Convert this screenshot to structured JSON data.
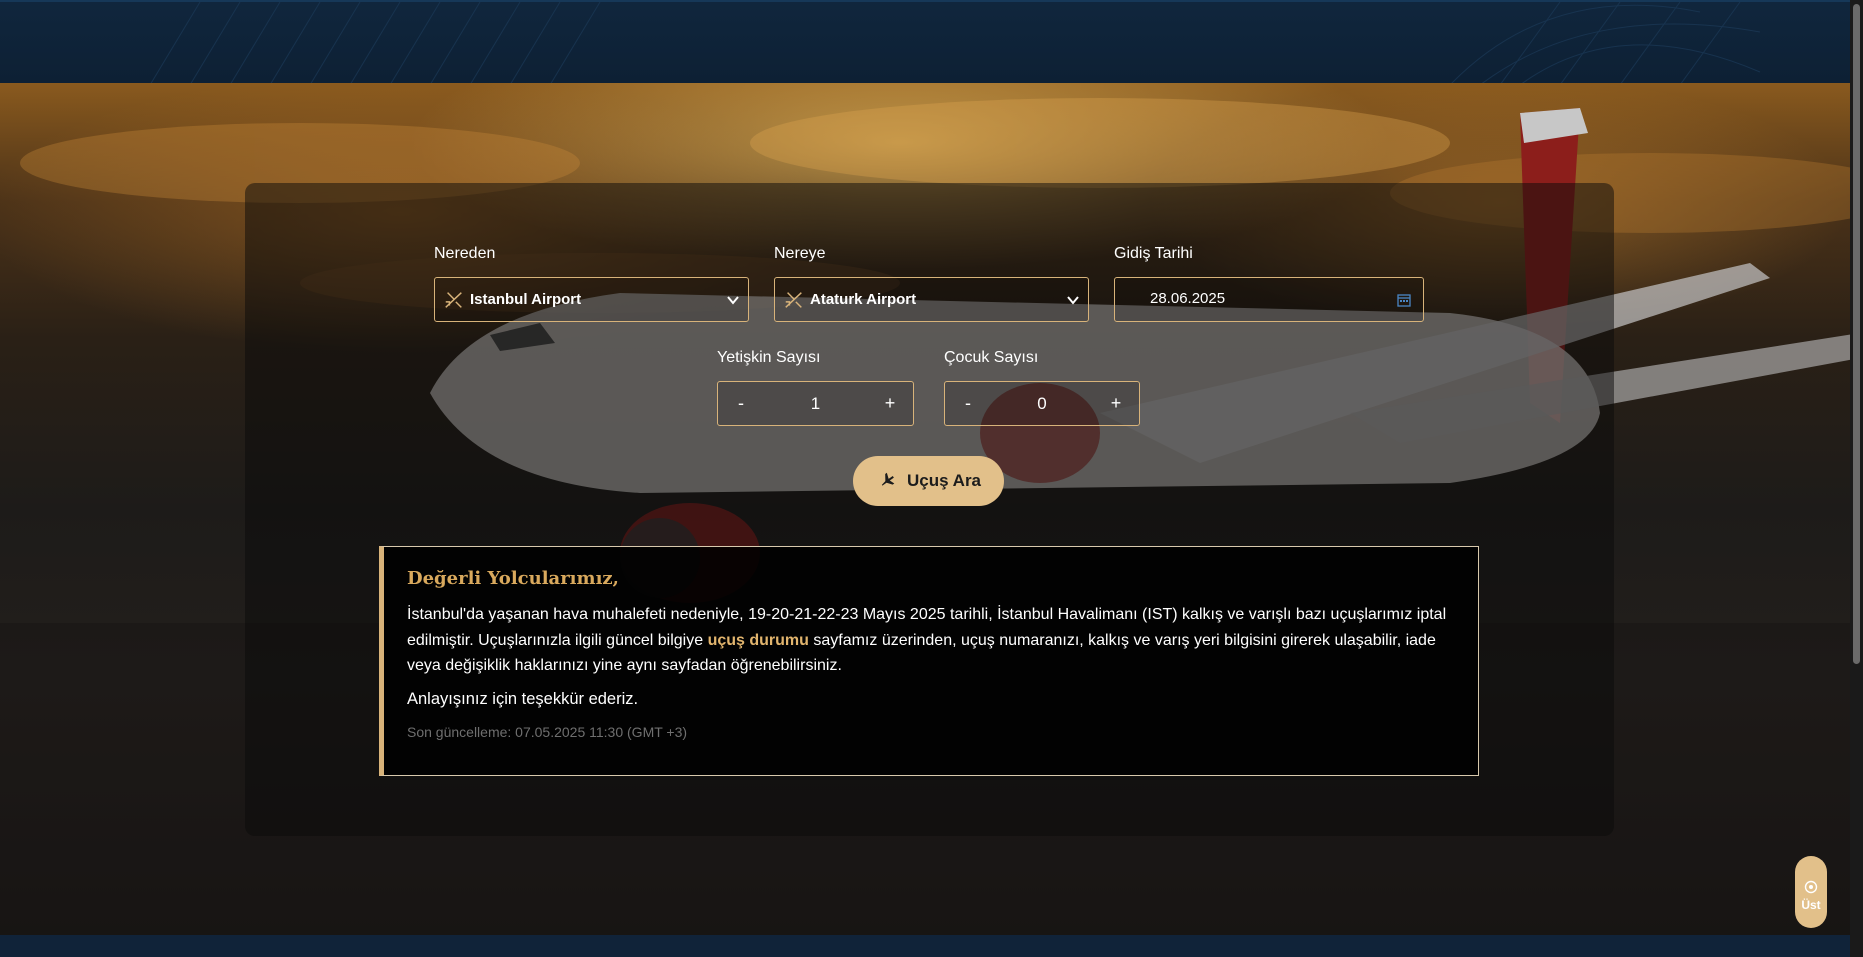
{
  "search_form": {
    "from": {
      "label": "Nereden",
      "value": "Istanbul Airport"
    },
    "to": {
      "label": "Nereye",
      "value": "Ataturk Airport"
    },
    "departure_date": {
      "label": "Gidiş Tarihi",
      "value": "28.06.2025"
    },
    "adults": {
      "label": "Yetişkin Sayısı",
      "value": "1",
      "minus": "-",
      "plus": "+"
    },
    "children": {
      "label": "Çocuk Sayısı",
      "value": "0",
      "minus": "-",
      "plus": "+"
    },
    "search_button": "Uçuş Ara"
  },
  "notice": {
    "title": "Değerli Yolcularımız,",
    "body_before_link": "İstanbul'da yaşanan hava muhalefeti nedeniyle, 19-20-21-22-23 Mayıs 2025 tarihli, İstanbul Havalimanı (IST) kalkış ve varışlı bazı uçuşlarımız iptal edilmiştir. Uçuşlarınızla ilgili güncel bilgiye ",
    "link_text": "uçuş durumu",
    "body_after_link": " sayfamız üzerinden, uçuş numaranızı, kalkış ve varış yeri bilgisini girerek ulaşabilir, iade veya değişiklik haklarınızı yine aynı sayfadan öğrenebilirsiniz.",
    "thanks": "Anlayışınız için teşekkür ederiz.",
    "last_updated": "Son güncelleme: 07.05.2025 11:30 (GMT +3)"
  },
  "back_to_top": "Üst",
  "icons": {
    "from_icon": "plane-departure-icon",
    "to_icon": "plane-departure-icon",
    "dropdown": "chevron-down-icon",
    "calendar": "calendar-icon",
    "search": "plane-icon",
    "back_to_top": "arrow-up-circle-icon"
  },
  "colors": {
    "accent": "#e2c08a",
    "link": "#e2b56e",
    "notice_title": "#d9a95d",
    "header_bg": "#10263d"
  }
}
